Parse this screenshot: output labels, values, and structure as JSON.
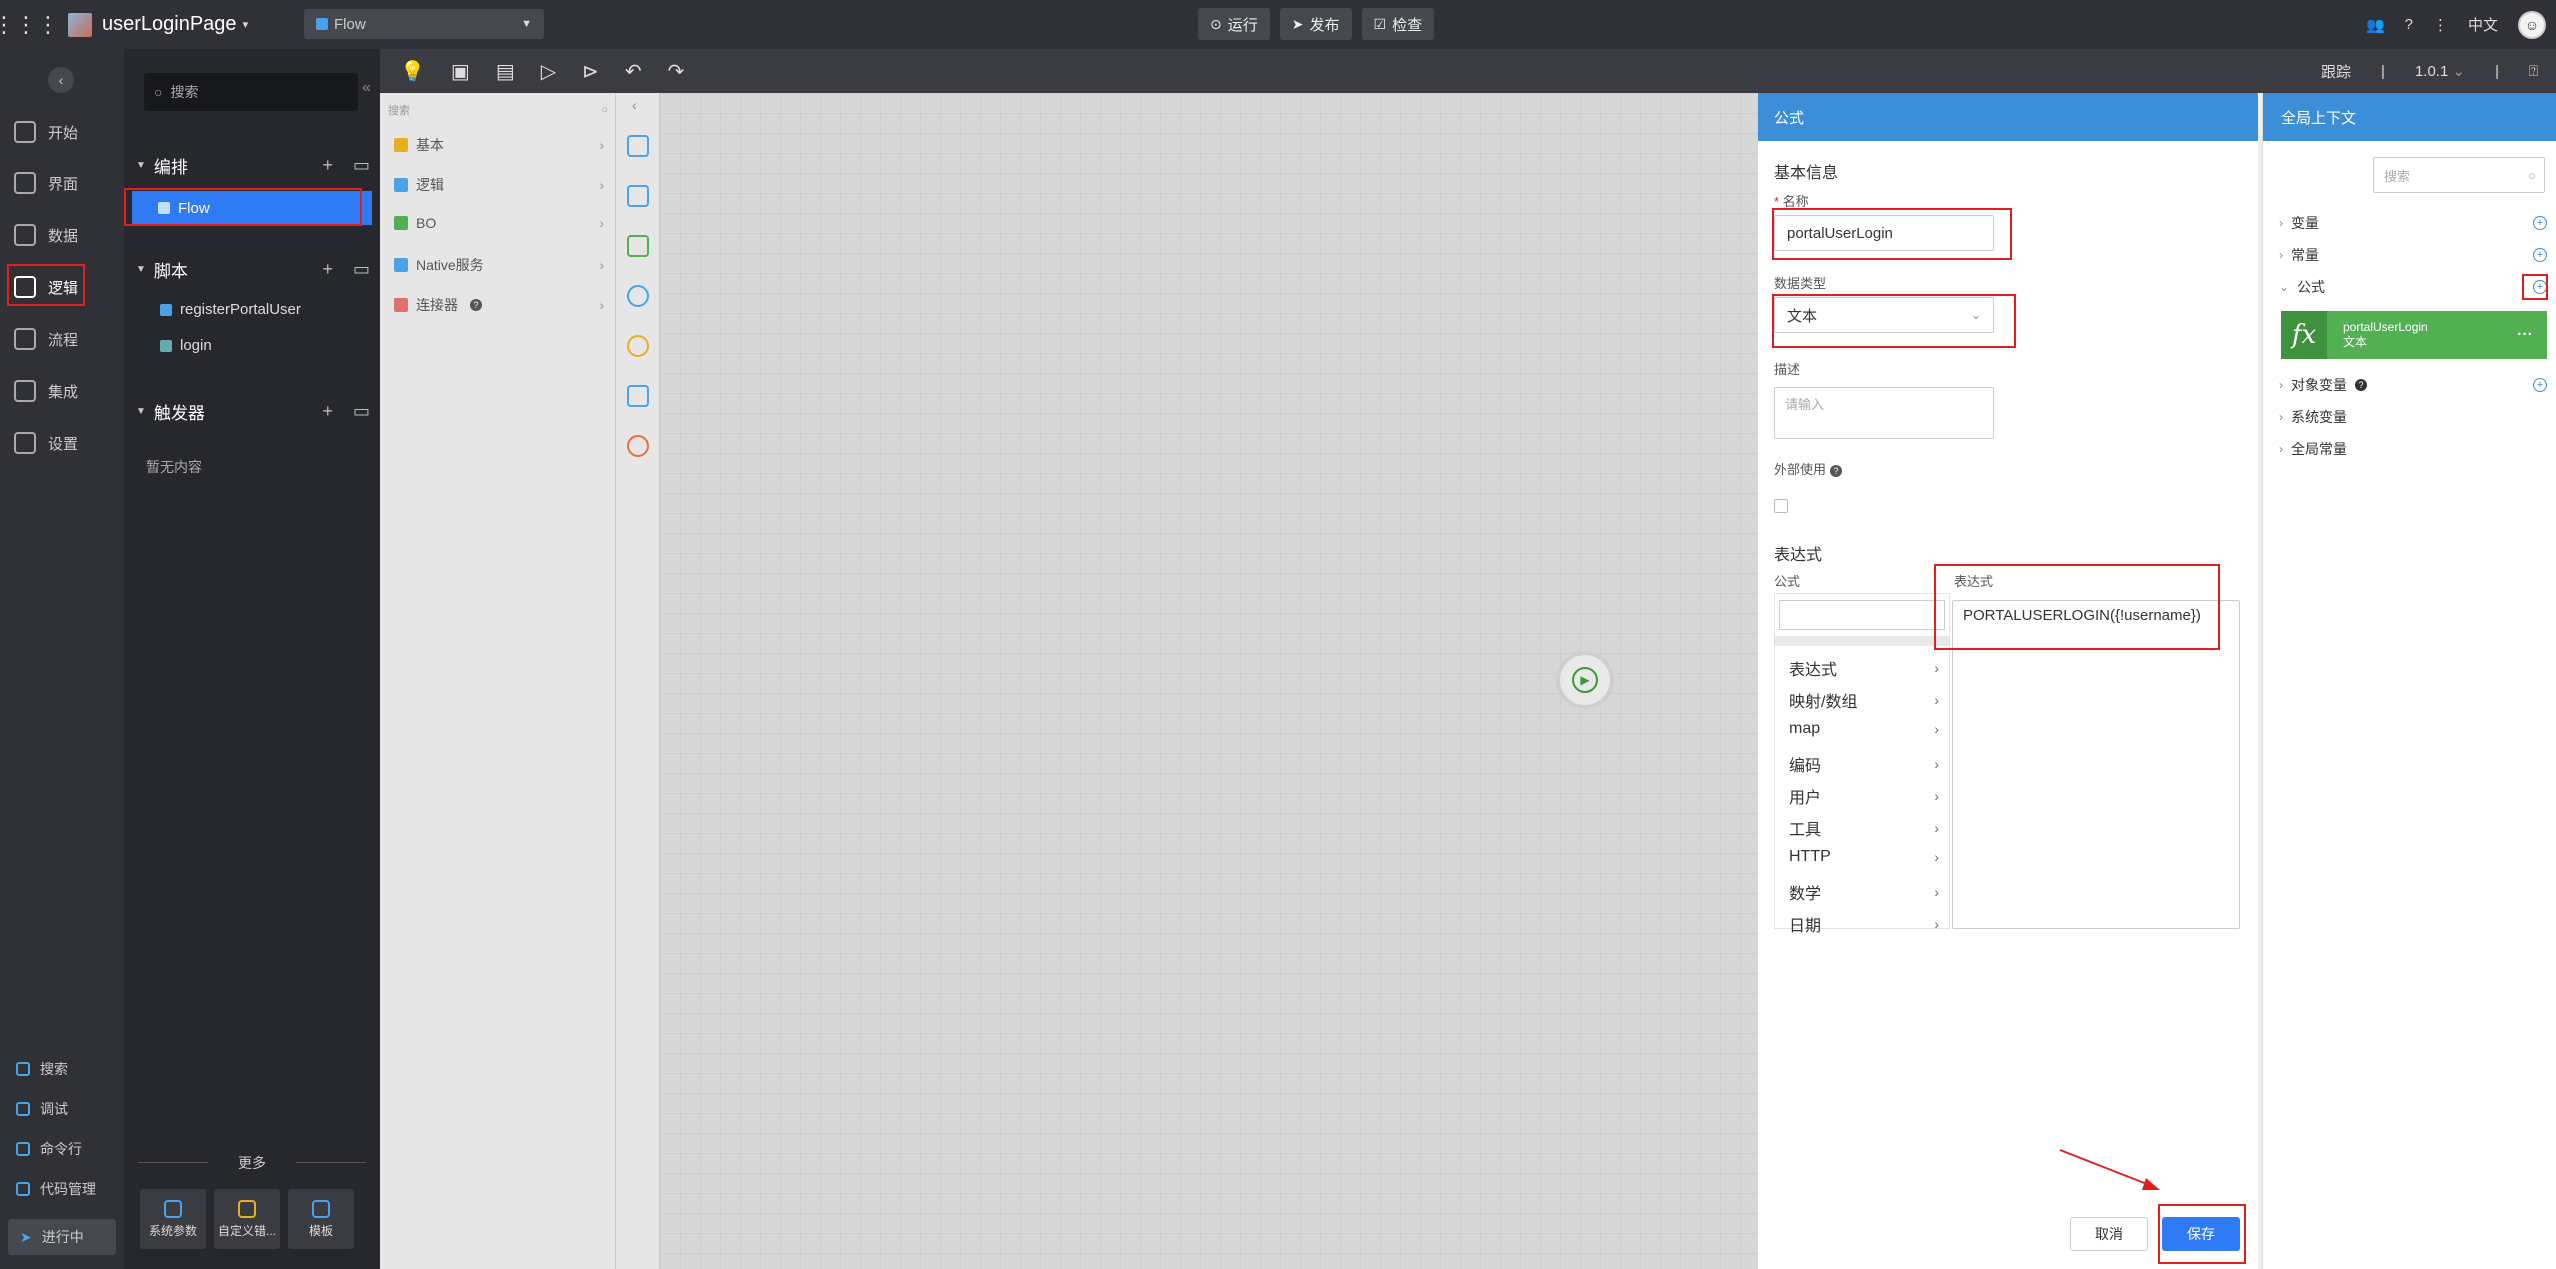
{
  "topbar": {
    "page_title": "userLoginPage",
    "flow_select": "Flow",
    "run_label": "运行",
    "publish_label": "发布",
    "check_label": "检查",
    "language": "中文"
  },
  "leftnav": {
    "items": [
      {
        "label": "开始",
        "icon": "home-icon"
      },
      {
        "label": "界面",
        "icon": "page-icon"
      },
      {
        "label": "数据",
        "icon": "table-icon"
      },
      {
        "label": "逻辑",
        "icon": "logic-icon"
      },
      {
        "label": "流程",
        "icon": "process-icon"
      },
      {
        "label": "集成",
        "icon": "integration-icon"
      },
      {
        "label": "设置",
        "icon": "settings-icon"
      }
    ],
    "bottom_items": [
      {
        "label": "搜索",
        "icon": "search-icon"
      },
      {
        "label": "调试",
        "icon": "debug-icon"
      },
      {
        "label": "命令行",
        "icon": "terminal-icon"
      },
      {
        "label": "代码管理",
        "icon": "code-icon"
      }
    ],
    "running_label": "进行中"
  },
  "explorer": {
    "search_placeholder": "搜索",
    "sections": {
      "orchestration": "编排",
      "script": "脚本",
      "trigger": "触发器"
    },
    "flow_item": "Flow",
    "script_items": [
      "registerPortalUser",
      "login"
    ],
    "trigger_empty": "暂无内容",
    "more_label": "更多",
    "more_buttons": [
      "系统参数",
      "自定义错...",
      "模板"
    ]
  },
  "canvas_toolbar": {
    "trace_label": "跟踪",
    "version": "1.0.1"
  },
  "palette": {
    "search_placeholder": "搜索",
    "items": [
      {
        "label": "基本",
        "color": "#e8b020"
      },
      {
        "label": "逻辑",
        "color": "#4aa3e8"
      },
      {
        "label": "BO",
        "color": "#52b052"
      },
      {
        "label": "Native服务",
        "color": "#4aa3e8"
      },
      {
        "label": "连接器",
        "color": "#e07070"
      }
    ]
  },
  "formula_panel": {
    "title": "公式",
    "basic_info": "基本信息",
    "name_label": "名称",
    "name_value": "portalUserLogin",
    "data_type_label": "数据类型",
    "data_type_value": "文本",
    "description_label": "描述",
    "description_placeholder": "请输入",
    "external_use_label": "外部使用",
    "expression_section": "表达式",
    "formula_col_label": "公式",
    "expression_col_label": "表达式",
    "function_categories": [
      "表达式",
      "映射/数组",
      "map",
      "编码",
      "用户",
      "工具",
      "HTTP",
      "数学",
      "日期"
    ],
    "expression_value": "PORTALUSERLOGIN({!username})",
    "cancel_label": "取消",
    "save_label": "保存"
  },
  "global_panel": {
    "title": "全局上下文",
    "search_placeholder": "搜索",
    "rows": {
      "variables": "变量",
      "constants": "常量",
      "formulas": "公式",
      "object_variables": "对象变量",
      "system_variables": "系统变量",
      "global_constants": "全局常量"
    },
    "formula_card": {
      "name": "portalUserLogin",
      "type": "文本"
    }
  },
  "colors": {
    "accent": "#2f7bf5",
    "panel_header": "#3d8ed8",
    "highlight_box": "#e02020",
    "formula_card": "#52b052"
  }
}
